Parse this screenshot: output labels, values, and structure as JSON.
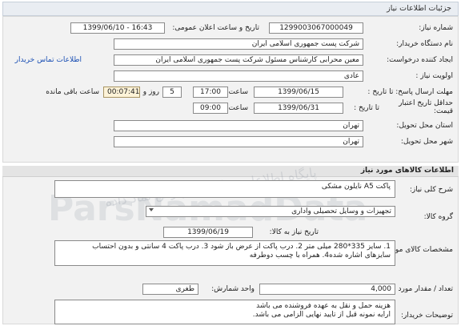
{
  "header": {
    "title": "جزئیات اطلاعات نیاز"
  },
  "details": {
    "need_number_label": "شماره نیاز:",
    "need_number": "1299003067000049",
    "announce_label": "تاریخ و ساعت اعلان عمومی:",
    "announce_value": "1399/06/10 - 16:43",
    "buyer_org_label": "نام دستگاه خریدار:",
    "buyer_org": "شرکت پست جمهوری اسلامی ایران",
    "creator_label": "ایجاد کننده درخواست:",
    "creator": "معین محرابی  کارشناس مسئول  شرکت پست جمهوری اسلامی ایران",
    "contact_link": "اطلاعات تماس خریدار",
    "priority_label": "اولویت نیاز :",
    "priority": "عادی",
    "send_deadline_label": "مهلت ارسال پاسخ:  تا تاریخ :",
    "send_deadline_date": "1399/06/15",
    "time_label": "ساعت",
    "send_deadline_time": "17:00",
    "days_value": "5",
    "days_label": "روز و",
    "remaining_time": "00:07:41",
    "remaining_label": "ساعت باقی مانده",
    "validity_label": "حداقل تاریخ اعتبار قیمت:",
    "validity_to_label": "تا تاریخ :",
    "validity_date": "1399/06/31",
    "validity_time_label": "ساعت",
    "validity_time": "09:00",
    "province_label": "استان محل تحویل:",
    "province": "تهران",
    "city_label": "شهر محل تحویل:",
    "city": "تهران"
  },
  "goods": {
    "section_title": "اطلاعات کالاهای مورد نیاز",
    "summary_label": "شرح کلی نیاز:",
    "summary": "پاکت A5 نایلون مشکی",
    "group_label": "گروه کالا:",
    "group": "تجهیزات و وسایل تحصیلی واداری",
    "need_date_label": "تاریخ نیاز به کالا:",
    "need_date": "1399/06/19",
    "desc_label": "مشخصات کالای مورد نیاز:",
    "desc_line1": "1. سایز 335*280 میلی متر 2. درب پاکت از عرض باز شود 3. درب پاکت 4 سانتی و بدون احتساب",
    "desc_line2": "سایزهای اشاره شده4. همراه با چسب دوطرفه",
    "qty_label": "تعداد / مقدار مورد نیاز:",
    "qty": "4,000",
    "unit_label": "واحد شمارش:",
    "unit": "طغری",
    "notes_label": "توضیحات خریدار:",
    "notes_line1": "هزینه حمل و نقل به عهده فروشنده می باشد",
    "notes_line2": "ارایه نمونه قبل از تایید نهایی الزامی می باشد."
  },
  "watermark": {
    "brand": "ParsNamadData",
    "slogan": "پایگاه اطلاعات مناقصات پارس نماد داده"
  }
}
